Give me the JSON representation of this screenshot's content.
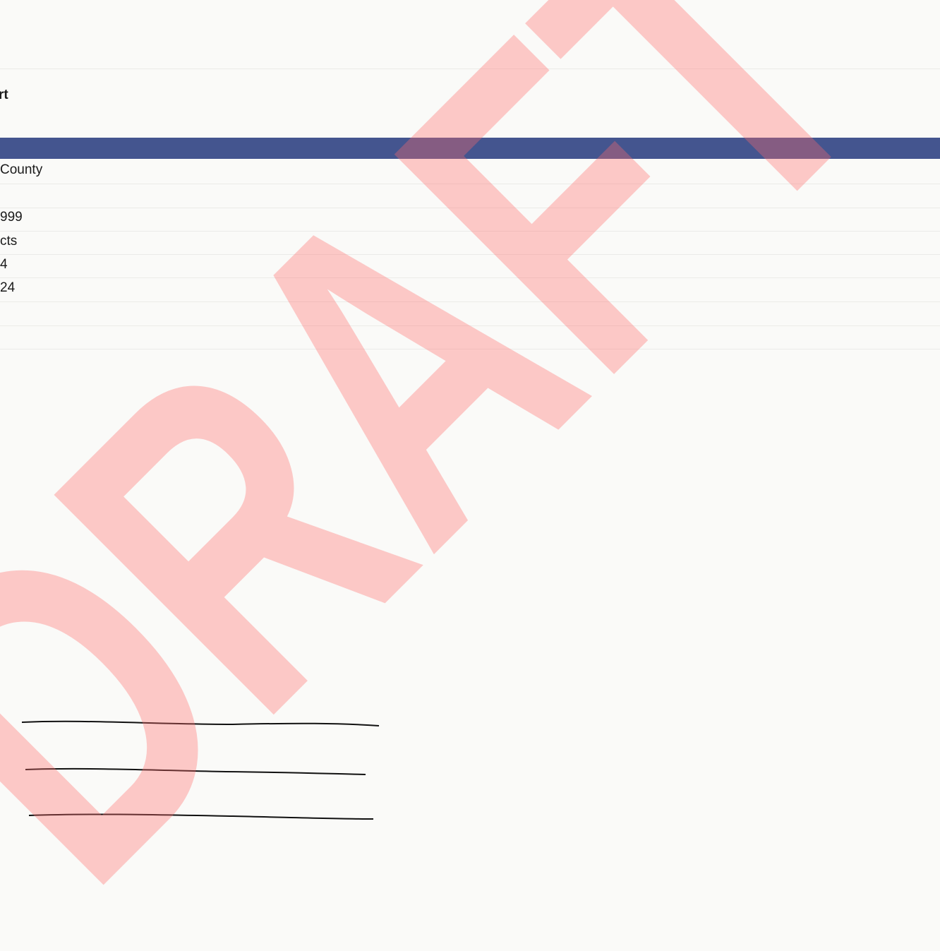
{
  "document": {
    "title_fragment": "rt",
    "rows": [
      "County",
      "",
      "999",
      "cts",
      "4",
      "24"
    ]
  },
  "signature_lines": {
    "count": 3
  },
  "watermark": {
    "text": "DRAFT",
    "color": "#ff6b6b"
  },
  "colors": {
    "header_band": "#44558f",
    "background": "#fafaf8"
  }
}
